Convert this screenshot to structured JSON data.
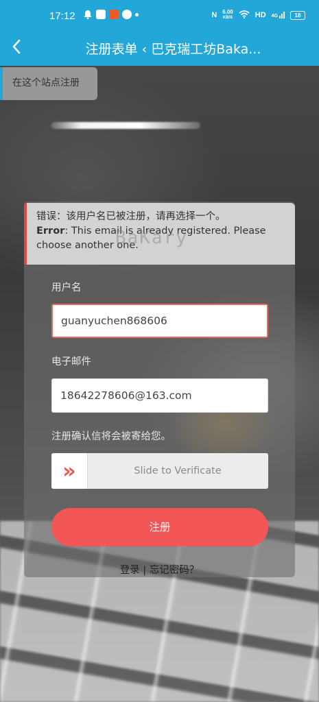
{
  "status_bar": {
    "time": "17:12",
    "net_speed": "6.00",
    "net_unit": "KB/S",
    "hd": "HD",
    "signal": "4G",
    "battery": "18"
  },
  "app_bar": {
    "title": "注册表单 ‹ 巴克瑞工坊Baka..."
  },
  "site_chip": {
    "label": "在这个站点注册"
  },
  "error": {
    "cn": "错误：该用户名已被注册，请再选择一个。",
    "en_prefix": "Error",
    "en_text": ": This email is already registered. Please choose another one."
  },
  "watermark": "BaKary",
  "form": {
    "username_label": "用户名",
    "username_value": "guanyuchen868606",
    "email_label": "电子邮件",
    "email_value": "18642278606@163.com",
    "hint": "注册确认信将会被寄给您。",
    "slider_text": "Slide to Verificate",
    "slider_handle": "»",
    "submit": "注册"
  },
  "footer": {
    "login": "登录",
    "separator": " | ",
    "forgot": "忘记密码？"
  },
  "colors": {
    "brand": "#23a6d8",
    "error": "#e04848",
    "button": "#f25656"
  }
}
